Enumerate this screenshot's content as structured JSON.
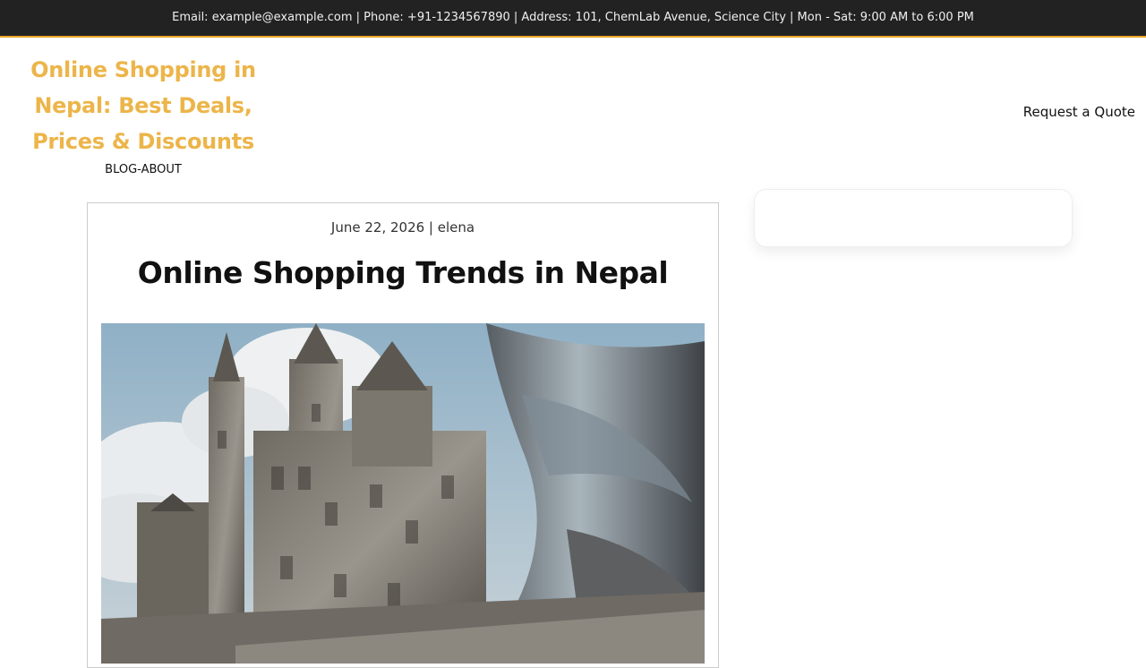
{
  "topbar": {
    "contact_info": "Email: example@example.com | Phone: +91-1234567890 | Address: 101, ChemLab Avenue, Science City | Mon - Sat: 9:00 AM to 6:00 PM"
  },
  "header": {
    "site_title": "Online Shopping in Nepal: Best Deals, Prices & Discounts",
    "nav_label": "BLOG-ABOUT",
    "quote_label": "Request a Quote"
  },
  "post": {
    "date": "June 22, 2026",
    "separator": " | ",
    "author": "elena",
    "title": "Online Shopping Trends in Nepal"
  },
  "colors": {
    "accent": "#ecb54a",
    "topbar_bg": "#222222",
    "topbar_border": "#e8a627"
  }
}
